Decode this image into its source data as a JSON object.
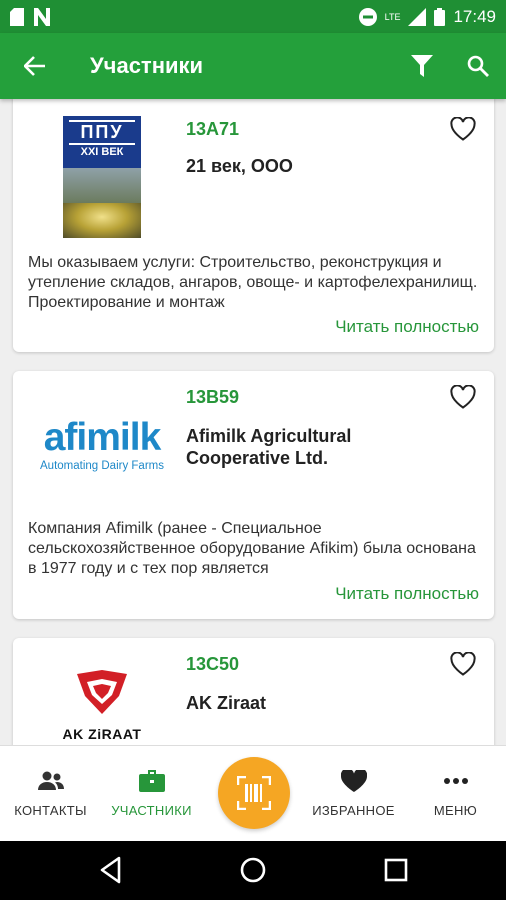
{
  "status_bar": {
    "time": "17:49",
    "network": "LTE"
  },
  "app_bar": {
    "title": "Участники"
  },
  "exhibitors": [
    {
      "code": "13A71",
      "name": "21 век, ООО",
      "logo_text_top": "ППУ",
      "logo_text_sub": "XXI ВЕК",
      "description": "Мы оказываем услуги: Строительство, реконструкция и утепление складов, ангаров, овоще- и картофелехранилищ. Проектирование и монтаж",
      "more_label": "Читать полностью"
    },
    {
      "code": "13B59",
      "name": "Afimilk Agricultural Cooperative Ltd.",
      "logo_text_top": "afimilk",
      "logo_text_sub": "Automating Dairy Farms",
      "description": "Компания Afimilk (ранее - Специальное сельскохозяйственное оборудование Afikim) была основана в 1977 году и с тех пор является",
      "more_label": "Читать полностью"
    },
    {
      "code": "13C50",
      "name": "AK Ziraat",
      "logo_text_sub": "AK ZiRAAT"
    }
  ],
  "bottom_nav": {
    "contacts": "КОНТАКТЫ",
    "participants": "УЧАСТНИКИ",
    "favorites": "ИЗБРАННОЕ",
    "menu": "МЕНЮ"
  },
  "colors": {
    "primary": "#24a03b",
    "status_bar": "#1f8f34",
    "accent": "#f5a623",
    "active_text": "#27963a"
  }
}
